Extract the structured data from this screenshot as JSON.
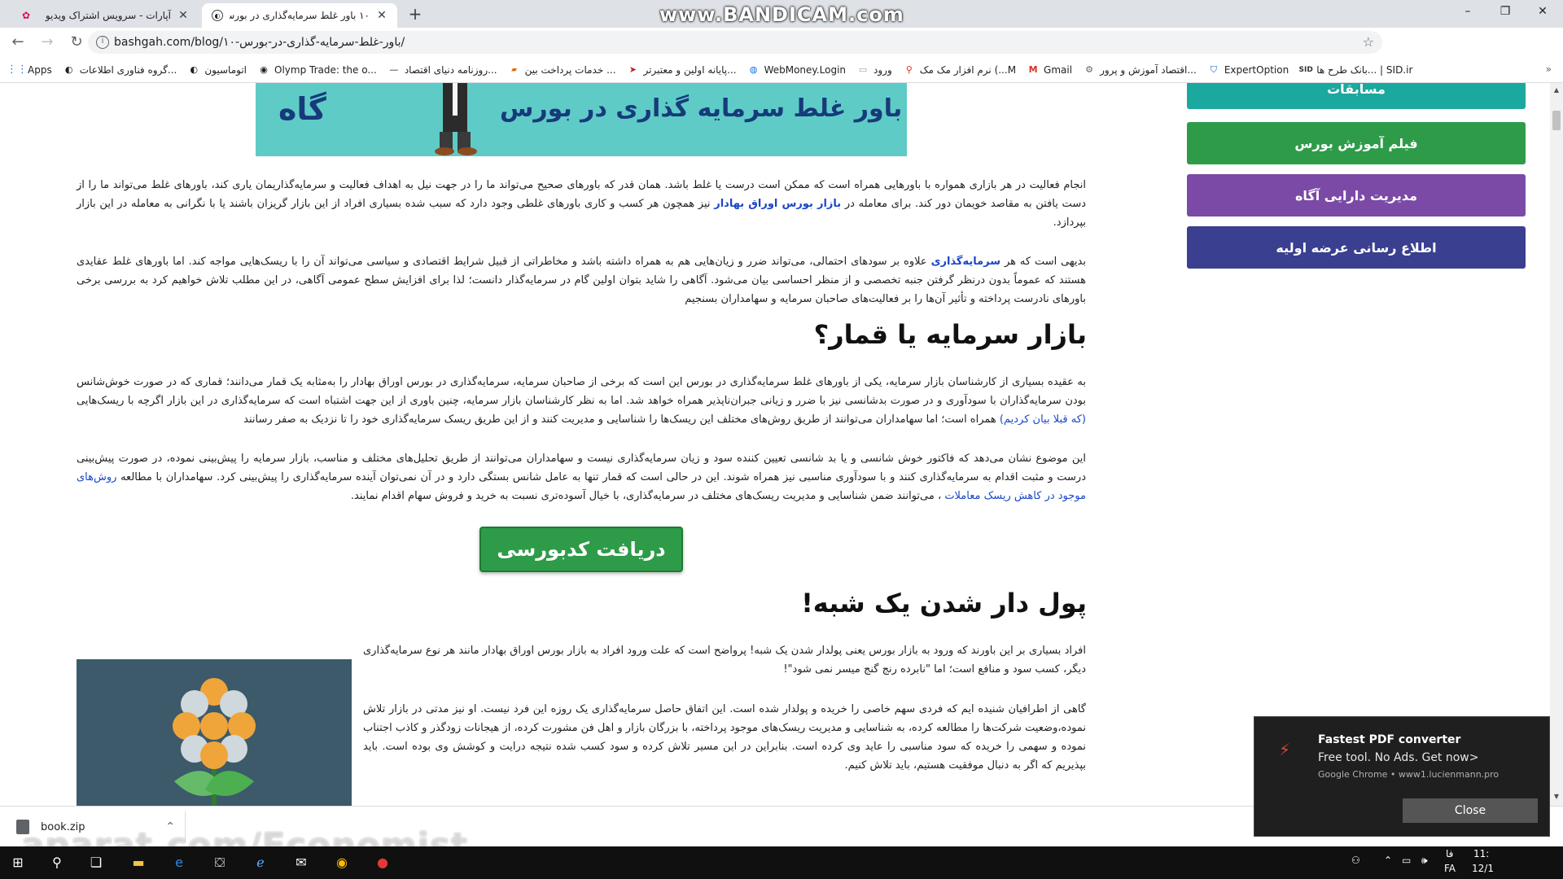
{
  "browser": {
    "tabs": [
      {
        "title": "آپارات - سرویس اشتراک ویدیو",
        "active": false
      },
      {
        "title": "۱۰ باور غلط سرمایه‌گذاری در بورس",
        "active": true
      }
    ],
    "watermark": "www.BANDICAM.com",
    "url": "bashgah.com/blog/۱۰-باور-غلط-سرمایه-گذاری-در-بورس/",
    "bookmarks": [
      "Apps",
      "گروه فناوری اطلاعات...",
      "اتوماسیون",
      "Olymp Trade: the o...",
      "روزنامه دنیای اقتصاد...",
      "خدمات پرداخت بین ...",
      "پایانه اولین و معتبرتر...",
      "WebMoney.Login",
      "ورود",
      "نرم افزار مک مک (...M",
      "Gmail",
      "اقتصاد آموزش و پرور...",
      "ExpertOption",
      "بانک طرح ها... | SID.ir"
    ],
    "bookmarks_more": "»"
  },
  "banner": {
    "text": "۱۰ باور غلط سرمایه گذاری در بورس",
    "brand": "گاه"
  },
  "sidebar": [
    {
      "label": "مسابقات",
      "color": "#1aa89f"
    },
    {
      "label": "فیلم آموزش بورس",
      "color": "#2e9b49"
    },
    {
      "label": "مدیریت دارایی آگاه",
      "color": "#7b4aa6"
    },
    {
      "label": "اطلاع رسانی عرضه اولیه",
      "color": "#3a3f8f"
    }
  ],
  "article": {
    "p1": "انجام فعالیت در هر بازاری همواره با باورهایی همراه است که ممکن است درست یا غلط باشد. همان قدر که باورهای صحیح می‌تواند ما را در جهت نیل به اهداف فعالیت و سرمایه‌گذاریمان یاری کند، باورهای غلط می‌تواند ما را از دست یافتن به مقاصد خویمان دور کند. برای معامله در",
    "p1_link": "بازار بورس اوراق بهادار",
    "p1_end": "نیز همچون هر کسب و کاری باورهای غلطی وجود دارد که سبب شده بسیاری افراد از این بازار گریزان باشند یا با نگرانی به معامله در این بازار بپردازد.",
    "p2_start": "بدیهی است که هر",
    "p2_link": "سرمایه‌گذاری",
    "p2_end": "علاوه بر سودهای احتمالی، می‌تواند ضرر و زیان‌هایی هم به همراه داشته باشد و مخاطراتی از قبیل شرایط اقتصادی و سیاسی می‌تواند آن را با ریسک‌هایی مواجه کند. اما باورهای غلط عقایدی هستند که عموماً بدون درنظر گرفتن جنبه تخصصی و از منظر احساسی بیان می‌شود. آگاهی را شاید بتوان اولین گام در سرمایه‌گذار دانست؛ لذا برای افزایش سطح عمومی آگاهی، در این مطلب تلاش خواهیم کرد به بررسی برخی باورهای نادرست پرداخته و تأثیر آن‌ها را بر فعالیت‌های صاحبان سرمایه و سهامداران بسنجیم",
    "h1": "بازار سرمایه یا قمار؟",
    "p3": "به عقیده بسیاری از کارشناسان بازار سرمایه، یکی از باورهای غلط سرمایه‌گذاری در بورس این است که برخی از صاحبان سرمایه، سرمایه‌گذاری در بورس اوراق بهادار را به‌مثابه یک قمار می‌دانند؛ قماری که در صورت خوش‌شانس بودن سرمایه‌گذاران با سودآوری و در صورت بدشانسی نیز با ضرر و زیانی جبران‌ناپذیر همراه خواهد شد. اما به نظر کارشناسان بازار سرمایه، چنین باوری از این جهت اشتباه است که سرمایه‌گذاری در این بازار اگرچه با ریسک‌هایی",
    "p3_link": "(که قبلا بیان کردیم)",
    "p3_end": "همراه است؛ اما سهامداران می‌توانند از طریق روش‌های مختلف این ریسک‌ها را شناسایی و مدیریت کنند و از این طریق ریسک سرمایه‌گذاری خود را تا نزدیک به صفر رسانند",
    "p4": "این موضوع نشان می‌دهد که فاکتور خوش شانسی و یا بد شانسی تعیین کننده سود و زیان سرمایه‌گذاری نیست و سهامداران می‌توانند از طریق تحلیل‌های مختلف و مناسب، بازار سرمایه را پیش‌بینی نموده، در صورت پیش‌بینی درست و مثبت اقدام به سرمایه‌گذاری کنند و با سودآوری مناسبی نیز همراه شوند. این در حالی است که قمار تنها به عامل شانس بستگی دارد و در آن نمی‌توان آینده سرمایه‌گذاری را پیش‌بینی کرد. سهامداران با مطالعه",
    "p4_link": "روش‌های موجود در کاهش ریسک معاملات",
    "p4_end": "، می‌توانند ضمن شناسایی و مدیریت ریسک‌های مختلف در سرمایه‌گذاری، با خیال آسوده‌تری نسبت به خرید و فروش سهام اقدام نمایند.",
    "cta": "دریافت کدبورسی",
    "h2": "پول دار شدن یک شبه!",
    "p5": "افراد بسیاری بر این باورند که ورود به بازار بورس یعنی پولدار شدن یک شبه! پرواضح است که علت ورود افراد به بازار بورس اوراق بهادار مانند هر نوع سرمایه‌گذاری دیگر، کسب سود و منافع است؛ اما \"نابرده رنج گنج میسر نمی شود\"!",
    "p6": "گاهی از اطرافیان شنیده ایم که فردی سهم خاصی را خریده و پولدار شده است. این اتفاق حاصل سرمایه‌گذاری یک روزه این فرد نیست. او نیز مدتی در بازار تلاش نموده،وضعیت شرکت‌ها را مطالعه کرده، به شناسایی و مدیریت ریسک‌های موجود پرداخته، با بزرگان بازار و اهل فن مشورت کرده، از هیجانات زودگذر و کاذب اجتناب نموده و سهمی را خریده که سود مناسبی را عاید وی کرده است. بنابراین در این مسیر تلاش کرده و سود کسب شده نتیجه درایت و کوشش وی بوده است. باید بپذیریم که اگر به دنبال موفقیت هستیم، باید تلاش کنیم."
  },
  "download": {
    "file": "book.zip"
  },
  "overlay_watermark": "aparat.com/Economist",
  "notification": {
    "title": "Fastest PDF converter",
    "body": "Free tool. No Ads. Get now>",
    "source": "Google Chrome • www1.lucienmann.pro",
    "close": "Close"
  },
  "tray": {
    "lang": "FA",
    "time": "11:",
    "date": "12/1",
    "fa": "فا"
  }
}
